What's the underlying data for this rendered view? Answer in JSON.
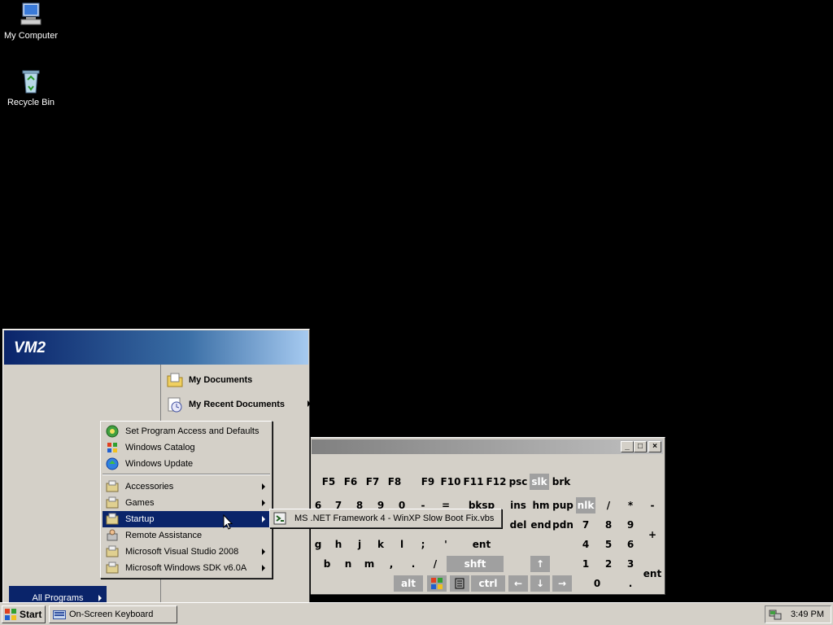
{
  "desktop": {
    "icons": [
      {
        "label": "My Computer",
        "icon": "my-computer-icon"
      },
      {
        "label": "Recycle Bin",
        "icon": "recycle-bin-icon"
      }
    ]
  },
  "start_menu": {
    "user": "VM2",
    "right_items": [
      {
        "label": "My Documents",
        "icon": "folder-documents-icon",
        "submenu": false
      },
      {
        "label": "My Recent Documents",
        "icon": "recent-documents-icon",
        "submenu": true
      }
    ],
    "all_programs_label": "All Programs"
  },
  "programs_menu": {
    "items": [
      {
        "label": "Set Program Access and Defaults",
        "icon": "program-access-icon",
        "submenu": false
      },
      {
        "label": "Windows Catalog",
        "icon": "windows-catalog-icon",
        "submenu": false
      },
      {
        "label": "Windows Update",
        "icon": "windows-update-icon",
        "submenu": false
      },
      {
        "label": "Accessories",
        "icon": "program-group-icon",
        "submenu": true
      },
      {
        "label": "Games",
        "icon": "program-group-icon",
        "submenu": true
      },
      {
        "label": "Startup",
        "icon": "program-group-icon",
        "submenu": true,
        "selected": true
      },
      {
        "label": "Remote Assistance",
        "icon": "remote-assistance-icon",
        "submenu": false
      },
      {
        "label": "Microsoft Visual Studio 2008",
        "icon": "program-group-icon",
        "submenu": true
      },
      {
        "label": "Microsoft Windows SDK v6.0A",
        "icon": "program-group-icon",
        "submenu": true
      }
    ]
  },
  "startup_menu": {
    "items": [
      {
        "label": "MS .NET Framework 4 - WinXP Slow Boot Fix.vbs",
        "icon": "vbs-script-icon"
      }
    ]
  },
  "osk": {
    "title_buttons": [
      "_",
      "□",
      "×"
    ],
    "rows": {
      "fn": [
        "F5",
        "F6",
        "F7",
        "F8",
        "F9",
        "F10",
        "F11",
        "F12",
        "psc",
        "slk",
        "brk"
      ],
      "row1": [
        "6",
        "7",
        "8",
        "9",
        "0",
        "-",
        "=",
        "bksp",
        "ins",
        "hm",
        "pup",
        "nlk",
        "/",
        "*",
        "-"
      ],
      "row2": [
        "del",
        "end",
        "pdn",
        "7",
        "8",
        "9",
        "+"
      ],
      "row3": [
        "g",
        "h",
        "j",
        "k",
        "l",
        ";",
        "'",
        "ent",
        "4",
        "5",
        "6"
      ],
      "row4": [
        "b",
        "n",
        "m",
        ",",
        ".",
        "/",
        "shft",
        "↑",
        "1",
        "2",
        "3"
      ],
      "row5": [
        "alt",
        "ctrl",
        "←",
        "↓",
        "→",
        "0",
        ".",
        "ent"
      ]
    }
  },
  "taskbar": {
    "start_label": "Start",
    "tasks": [
      {
        "label": "On-Screen Keyboard",
        "icon": "keyboard-icon"
      }
    ],
    "clock": "3:49 PM",
    "tray_icon": "network-tray-icon"
  }
}
